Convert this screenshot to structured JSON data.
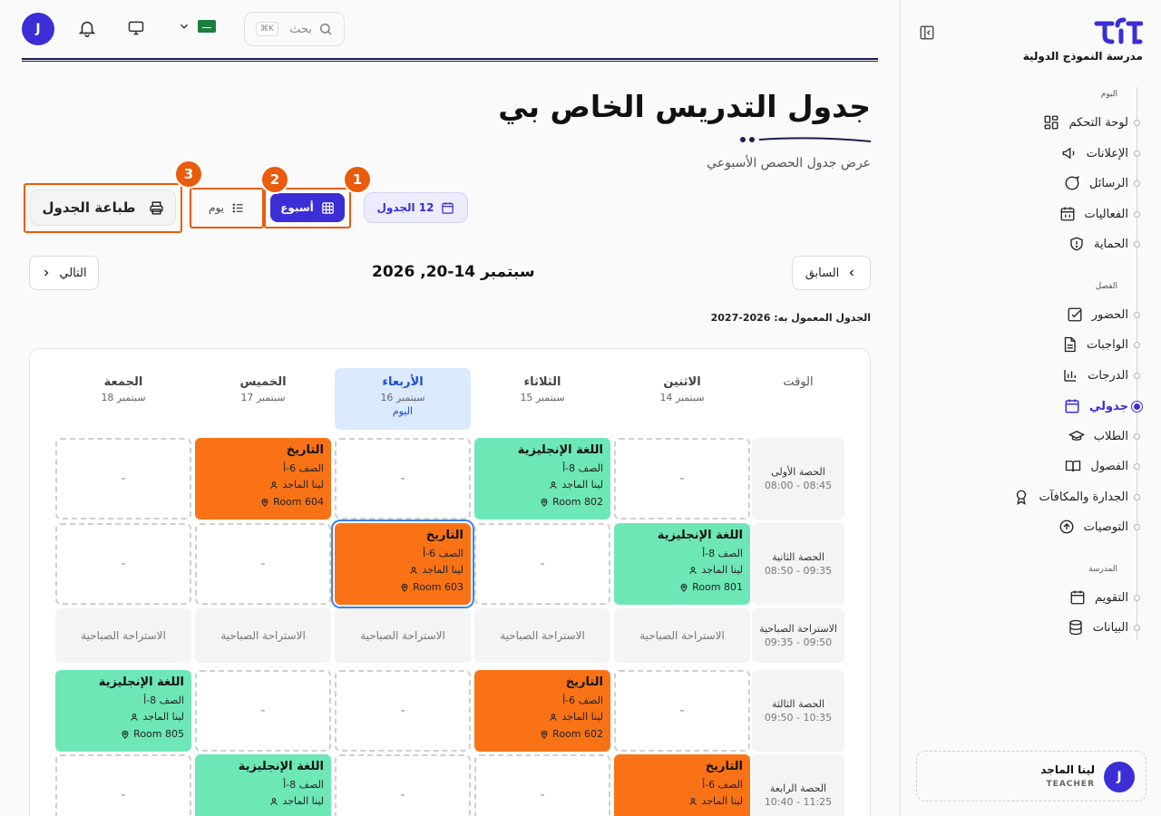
{
  "topbar": {
    "avatar_letter": "J",
    "search_label": "بحث",
    "search_shortcut": "K⌘",
    "icons": [
      "bell-icon",
      "monitor-icon",
      "chevron-down-icon",
      "saudi-flag-icon",
      "search-icon"
    ]
  },
  "sidebar": {
    "school_name": "مدرسة النموذج الدولية",
    "sections": {
      "today": "اليوم",
      "class": "الفصل",
      "school": "المدرسة"
    },
    "items": [
      {
        "label": "لوحة التحكم",
        "icon": "dashboard-icon"
      },
      {
        "label": "الإعلانات",
        "icon": "megaphone-icon"
      },
      {
        "label": "الرسائل",
        "icon": "chat-icon"
      },
      {
        "label": "الفعاليات",
        "icon": "calendar-grid-icon"
      },
      {
        "label": "الحماية",
        "icon": "shield-icon"
      },
      {
        "label": "الحضور",
        "icon": "check-square-icon"
      },
      {
        "label": "الواجبات",
        "icon": "document-icon"
      },
      {
        "label": "الدرجات",
        "icon": "bar-chart-icon"
      },
      {
        "label": "جدولي",
        "icon": "calendar-icon",
        "active": true
      },
      {
        "label": "الطلاب",
        "icon": "graduation-cap-icon"
      },
      {
        "label": "الفصول",
        "icon": "book-icon"
      },
      {
        "label": "الجدارة والمكافآت",
        "icon": "award-icon"
      },
      {
        "label": "التوصيات",
        "icon": "arrow-up-circle-icon"
      },
      {
        "label": "التقويم",
        "icon": "calendar-icon"
      },
      {
        "label": "البيانات",
        "icon": "database-icon"
      }
    ],
    "user": {
      "name": "لينا الماجد",
      "role": "TEACHER",
      "initial": "J"
    }
  },
  "header": {
    "title": "جدول التدريس الخاص بي",
    "subtitle": "عرض جدول الحصص الأسبوعي"
  },
  "toolbar": {
    "counter_label": "12 الجدول",
    "week_label": "أسبوع",
    "day_label": "يوم",
    "print_label": "طباعة الجدول",
    "badges": [
      "1",
      "2",
      "3"
    ]
  },
  "nav": {
    "prev_label": "السابق",
    "next_label": "التالي",
    "week_range": "سبتمبر 14-20, 2026",
    "year_note": "الجدول المعمول به: 2026-2027"
  },
  "schedule": {
    "time_header": "الوقت",
    "today_tag": "اليوم",
    "days": [
      {
        "name": "الاثنين",
        "date": "سبتمبر 14"
      },
      {
        "name": "الثلاثاء",
        "date": "سبتمبر 15"
      },
      {
        "name": "الأربعاء",
        "date": "سبتمبر 16",
        "today": true
      },
      {
        "name": "الخميس",
        "date": "سبتمبر 17"
      },
      {
        "name": "الجمعة",
        "date": "سبتمبر 18"
      }
    ],
    "colors": {
      "english": "#6ee7b7",
      "history": "#f97316",
      "today": "#dbeafe",
      "accent": "#3b2ed6",
      "highlight": "#ea5b0c"
    },
    "rows": [
      {
        "name": "الحصة الأولى",
        "time": "08:00 - 08:45",
        "cells": [
          {
            "type": "empty",
            "text": "-"
          },
          {
            "type": "lesson",
            "subject": "اللغة الإنجليزية",
            "class": "الصف 8-أ",
            "teacher": "لينا الماجد",
            "room": "Room 802",
            "color": "green"
          },
          {
            "type": "empty",
            "text": "-"
          },
          {
            "type": "lesson",
            "subject": "التاريخ",
            "class": "الصف 6-أ",
            "teacher": "لينا الماجد",
            "room": "Room 604",
            "color": "orange"
          },
          {
            "type": "empty",
            "text": "-"
          }
        ]
      },
      {
        "name": "الحصة الثانية",
        "time": "08:50 - 09:35",
        "cells": [
          {
            "type": "lesson",
            "subject": "اللغة الإنجليزية",
            "class": "الصف 8-أ",
            "teacher": "لينا الماجد",
            "room": "Room 801",
            "color": "green"
          },
          {
            "type": "empty",
            "text": "-"
          },
          {
            "type": "lesson",
            "subject": "التاريخ",
            "class": "الصف 6-أ",
            "teacher": "لينا الماجد",
            "room": "Room 603",
            "color": "orange",
            "selected": true
          },
          {
            "type": "empty",
            "text": "-"
          },
          {
            "type": "empty",
            "text": "-"
          }
        ]
      },
      {
        "name": "الاستراحة الصباحية",
        "time": "09:35 - 09:50",
        "cells": [
          {
            "type": "break",
            "text": "الاستراحة الصباحية"
          },
          {
            "type": "break",
            "text": "الاستراحة الصباحية"
          },
          {
            "type": "break",
            "text": "الاستراحة الصباحية"
          },
          {
            "type": "break",
            "text": "الاستراحة الصباحية"
          },
          {
            "type": "break",
            "text": "الاستراحة الصباحية"
          }
        ]
      },
      {
        "name": "الحصة الثالثة",
        "time": "09:50 - 10:35",
        "cells": [
          {
            "type": "empty",
            "text": "-"
          },
          {
            "type": "lesson",
            "subject": "التاريخ",
            "class": "الصف 6-أ",
            "teacher": "لينا الماجد",
            "room": "Room 602",
            "color": "orange"
          },
          {
            "type": "empty",
            "text": "-"
          },
          {
            "type": "empty",
            "text": "-"
          },
          {
            "type": "lesson",
            "subject": "اللغة الإنجليزية",
            "class": "الصف 8-أ",
            "teacher": "لينا الماجد",
            "room": "Room 805",
            "color": "green"
          }
        ]
      },
      {
        "name": "الحصة الرابعة",
        "time": "10:40 - 11:25",
        "cells": [
          {
            "type": "lesson",
            "subject": "التاريخ",
            "class": "الصف 6-أ",
            "teacher": "لينا الماجد",
            "room": "",
            "color": "orange"
          },
          {
            "type": "empty",
            "text": "-"
          },
          {
            "type": "empty",
            "text": "-"
          },
          {
            "type": "lesson",
            "subject": "اللغة الإنجليزية",
            "class": "الصف 8-أ",
            "teacher": "لينا الماجد",
            "room": "",
            "color": "green"
          },
          {
            "type": "empty",
            "text": "-"
          }
        ]
      }
    ]
  }
}
